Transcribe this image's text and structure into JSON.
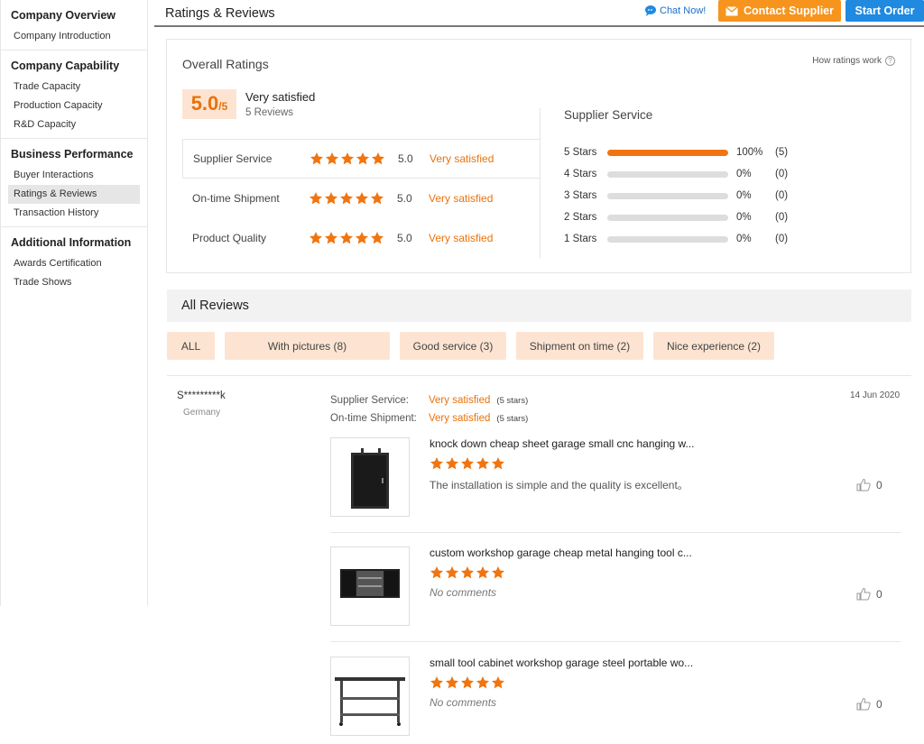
{
  "sidebar": {
    "groups": [
      {
        "title": "Company Overview",
        "items": [
          "Company Introduction"
        ]
      },
      {
        "title": "Company Capability",
        "items": [
          "Trade Capacity",
          "Production Capacity",
          "R&D Capacity"
        ]
      },
      {
        "title": "Business Performance",
        "items": [
          "Buyer Interactions",
          "Ratings & Reviews",
          "Transaction History"
        ]
      },
      {
        "title": "Additional Information",
        "items": [
          "Awards Certification",
          "Trade Shows"
        ]
      }
    ],
    "active_item": "Ratings & Reviews"
  },
  "header": {
    "title": "Ratings & Reviews",
    "chat_label": "Chat Now!",
    "contact_label": "Contact Supplier",
    "start_order_label": "Start Order"
  },
  "overall": {
    "title": "Overall Ratings",
    "how_ratings_work": "How ratings work",
    "score": "5.0",
    "score_max": "/5",
    "score_label": "Very satisfied",
    "review_count": "5 Reviews",
    "sub_ratings": [
      {
        "name": "Supplier Service",
        "stars": 5,
        "value": "5.0",
        "label": "Very satisfied"
      },
      {
        "name": "On-time Shipment",
        "stars": 5,
        "value": "5.0",
        "label": "Very satisfied"
      },
      {
        "name": "Product Quality",
        "stars": 5,
        "value": "5.0",
        "label": "Very satisfied"
      }
    ],
    "supplier_service": {
      "title": "Supplier Service",
      "distribution": [
        {
          "label": "5  Stars",
          "fraction": 1.0,
          "pct": "100%",
          "count": "(5)"
        },
        {
          "label": "4  Stars",
          "fraction": 0,
          "pct": "0%",
          "count": "(0)"
        },
        {
          "label": "3  Stars",
          "fraction": 0,
          "pct": "0%",
          "count": "(0)"
        },
        {
          "label": "2  Stars",
          "fraction": 0,
          "pct": "0%",
          "count": "(0)"
        },
        {
          "label": "1  Stars",
          "fraction": 0,
          "pct": "0%",
          "count": "(0)"
        }
      ]
    }
  },
  "reviews": {
    "title": "All Reviews",
    "filters": [
      "ALL",
      "With pictures (8)",
      "Good service (3)",
      "Shipment on time (2)",
      "Nice experience (2)"
    ],
    "items": [
      {
        "reviewer": "S*********k",
        "country": "Germany",
        "date": "14 Jun 2020",
        "meta": [
          {
            "label": "Supplier Service:",
            "value": "Very satisfied",
            "note": "(5 stars)"
          },
          {
            "label": "On-time Shipment:",
            "value": "Very satisfied",
            "note": "(5 stars)"
          }
        ],
        "products": [
          {
            "name": "knock down cheap sheet garage small cnc hanging w...",
            "stars": 5,
            "comment": "The installation is simple and the quality is excellent。",
            "empty": false,
            "likes": "0",
            "thumb": "cabinet"
          },
          {
            "name": "custom workshop garage cheap metal hanging tool c...",
            "stars": 5,
            "comment": "No comments",
            "empty": true,
            "likes": "0",
            "thumb": "wall-cabinet"
          },
          {
            "name": "small tool cabinet workshop garage steel portable wo...",
            "stars": 5,
            "comment": "No comments",
            "empty": true,
            "likes": "0",
            "thumb": "table"
          }
        ]
      }
    ]
  },
  "colors": {
    "accent": "#e8720c",
    "contact_button": "#f7941d",
    "start_button": "#1f8ae0",
    "chip_bg": "#fde4d2",
    "star": "#f07510"
  }
}
